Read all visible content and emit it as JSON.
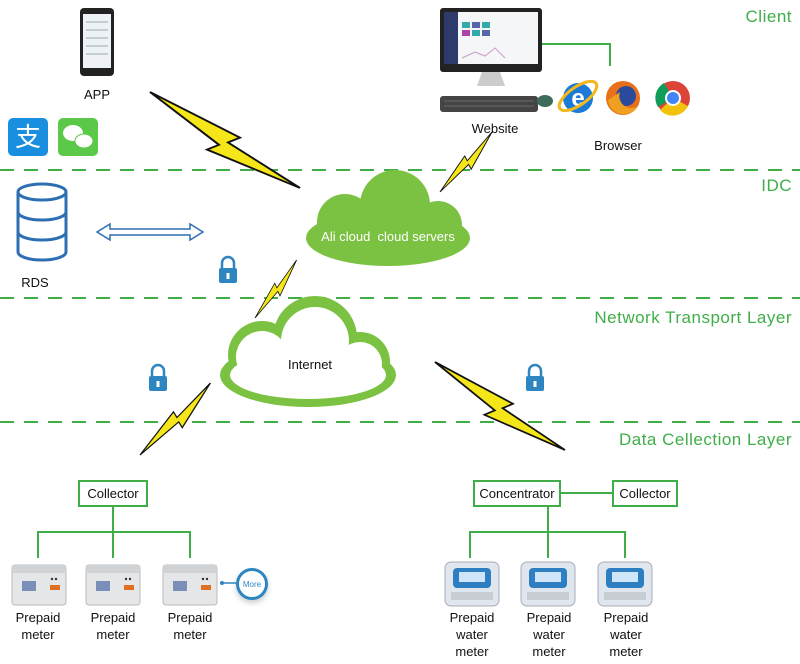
{
  "layers": {
    "client": "Client",
    "idc": "IDC",
    "network": "Network Transport Layer",
    "data": "Data Cellection Layer"
  },
  "client": {
    "app_label": "APP",
    "website_label": "Website",
    "browser_label": "Browser",
    "icons": [
      "phone-icon",
      "alipay-icon",
      "wechat-icon",
      "monitor-icon",
      "keyboard-icon",
      "mouse-icon",
      "ie-icon",
      "firefox-icon",
      "chrome-icon"
    ]
  },
  "idc": {
    "rds_label": "RDS",
    "cloud_label": "Ali cloud  cloud servers"
  },
  "network": {
    "internet_label": "Internet"
  },
  "collection": {
    "left_collector": "Collector",
    "meters": [
      {
        "line1": "Prepaid",
        "line2": "meter"
      },
      {
        "line1": "Prepaid",
        "line2": "meter"
      },
      {
        "line1": "Prepaid",
        "line2": "meter"
      }
    ],
    "more_label": "More",
    "concentrator": "Concentrator",
    "right_collector": "Collector",
    "water_meters": [
      {
        "line1": "Prepaid",
        "line2": "water",
        "line3": "meter"
      },
      {
        "line1": "Prepaid",
        "line2": "water",
        "line3": "meter"
      },
      {
        "line1": "Prepaid",
        "line2": "water",
        "line3": "meter"
      }
    ]
  },
  "colors": {
    "accent": "#3fae49",
    "bolt": "#f5e61a",
    "lock": "#2e86c1"
  }
}
